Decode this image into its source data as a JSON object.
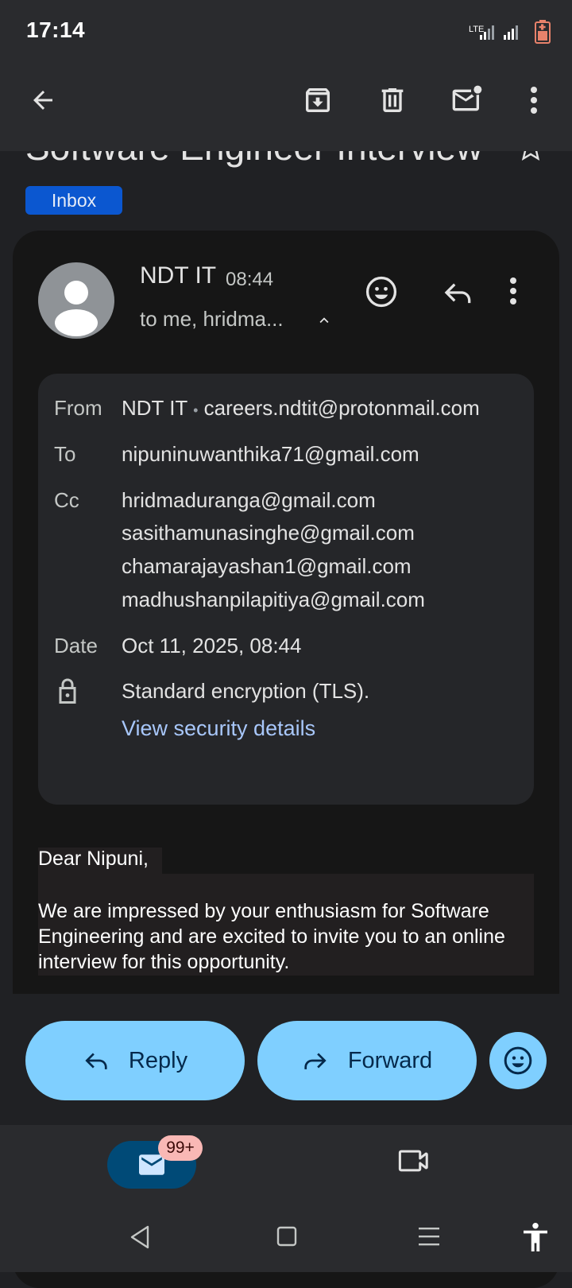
{
  "status_bar": {
    "time": "17:14",
    "network": "LTE"
  },
  "app_bar": {
    "icons": [
      "back-arrow-icon",
      "archive-icon",
      "delete-icon",
      "mark-unread-icon",
      "more-vert-icon"
    ]
  },
  "email": {
    "subject": "Software Engineer Interview",
    "label": "Inbox",
    "sender": "NDT IT",
    "time": "08:44",
    "recipients_summary": "to me, hridma...",
    "details": {
      "from_label": "From",
      "from_name": "NDT IT",
      "separator": "•",
      "from_email": "careers.ndtit@protonmail.com",
      "to_label": "To",
      "to": "nipuninuwanthika71@gmail.com",
      "cc_label": "Cc",
      "cc": [
        "hridmaduranga@gmail.com",
        "sasithamunasinghe@gmail.com",
        "chamarajayashan1@gmail.com",
        "madhushanpilapitiya@gmail.com"
      ],
      "date_label": "Date",
      "date": "Oct 11, 2025, 08:44",
      "encryption": "Standard encryption (TLS).",
      "security_link": "View security details"
    },
    "body": {
      "greeting": "Dear Nipuni,",
      "paragraph": "We are impressed by your enthusiasm for Software Engineering and are excited to invite you to an online interview for this opportunity."
    }
  },
  "actions": {
    "reply": "Reply",
    "forward": "Forward"
  },
  "bottom_nav": {
    "mail_badge": "99+"
  },
  "colors": {
    "accent_pill": "#7fcfff",
    "link": "#a8c7fa",
    "inbox_badge": "#0b57d0"
  }
}
